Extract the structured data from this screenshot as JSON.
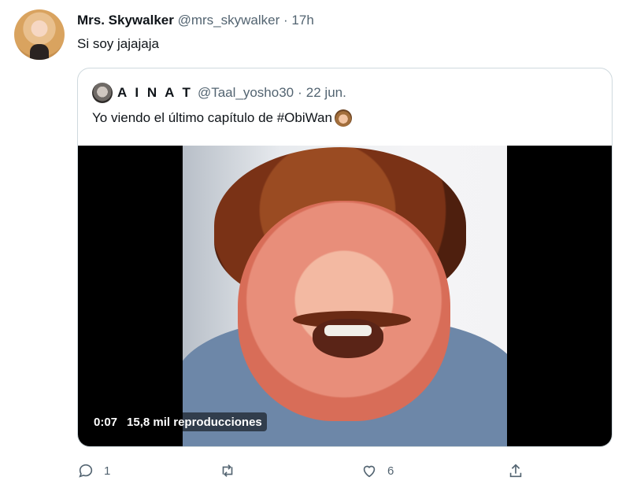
{
  "tweet": {
    "author_name": "Mrs. Skywalker",
    "author_handle": "@mrs_skywalker",
    "separator": "·",
    "time": "17h",
    "text": "Si soy jajajaja",
    "actions": {
      "reply_count": "1",
      "retweet_count": "",
      "like_count": "6"
    }
  },
  "quote": {
    "author_name": "A I N A T",
    "author_handle": "@Taal_yosho30",
    "separator": "·",
    "date": "22 jun.",
    "text": "Yo viendo el último capítulo de #ObiWan",
    "video": {
      "duration": "0:07",
      "views": "15,8 mil reproducciones"
    }
  },
  "icons": [
    "reply-icon",
    "retweet-icon",
    "like-icon",
    "share-icon"
  ]
}
